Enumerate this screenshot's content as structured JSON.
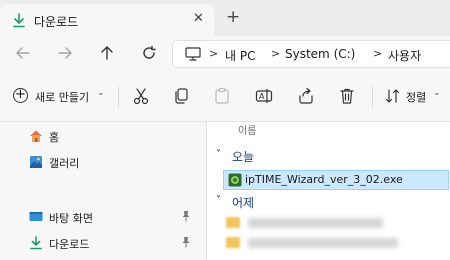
{
  "tab": {
    "title": "다운로드",
    "close": "✕",
    "new": "+"
  },
  "address": {
    "parts": [
      "내 PC",
      "System (C:)",
      "사용자"
    ],
    "separator": ">"
  },
  "command_bar": {
    "new_label": "새로 만들기",
    "sort_label": "정렬"
  },
  "sidebar": {
    "items": [
      {
        "label": "홈",
        "icon": "home-icon"
      },
      {
        "label": "갤러리",
        "icon": "gallery-icon"
      },
      {
        "label": "바탕 화면",
        "icon": "desktop-icon",
        "pinned": true
      },
      {
        "label": "다운로드",
        "icon": "download-icon",
        "pinned": true
      }
    ]
  },
  "main": {
    "column_header": "이름",
    "groups": [
      {
        "label": "오늘"
      },
      {
        "label": "어제"
      }
    ],
    "selected_file": "ipTIME_Wizard_ver_3_02.exe"
  },
  "colors": {
    "accent": "#0067c0",
    "selection_bg": "#cce8ff",
    "selection_border": "#99d1ff",
    "download_green": "#1a9d6b"
  }
}
